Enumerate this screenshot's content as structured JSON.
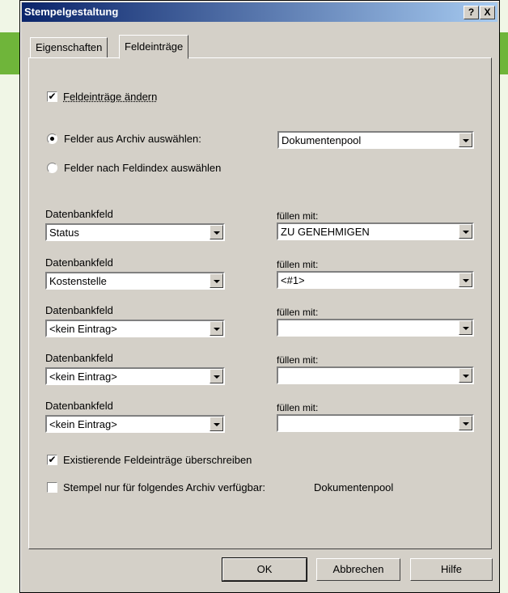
{
  "window": {
    "title": "Stempelgestaltung",
    "help_label": "?",
    "close_label": "X"
  },
  "tabs": [
    {
      "label": "Eigenschaften",
      "active": false
    },
    {
      "label": "Feldeinträge",
      "active": true
    }
  ],
  "feld": {
    "change_label": "Feldeinträge ändern",
    "change_checked": true,
    "archive_radio_label": "Felder aus Archiv auswählen:",
    "index_radio_label": "Felder nach Feldindex auswählen",
    "archive_selected": "Dokumentenpool"
  },
  "rows": [
    {
      "field_label": "Datenbankfeld",
      "field_value": "Status",
      "fill_label": "füllen mit:",
      "fill_value": "ZU GENEHMIGEN"
    },
    {
      "field_label": "Datenbankfeld",
      "field_value": "Kostenstelle",
      "fill_label": "füllen mit:",
      "fill_value": "<#1>"
    },
    {
      "field_label": "Datenbankfeld",
      "field_value": "<kein Eintrag>",
      "fill_label": "füllen mit:",
      "fill_value": ""
    },
    {
      "field_label": "Datenbankfeld",
      "field_value": "<kein Eintrag>",
      "fill_label": "füllen mit:",
      "fill_value": ""
    },
    {
      "field_label": "Datenbankfeld",
      "field_value": "<kein Eintrag>",
      "fill_label": "füllen mit:",
      "fill_value": ""
    }
  ],
  "options": {
    "overwrite_label": "Existierende Feldeinträge überschreiben",
    "overwrite_checked": true,
    "archive_only_label": "Stempel nur für folgendes Archiv verfügbar:",
    "archive_only_checked": false,
    "archive_only_value": "Dokumentenpool"
  },
  "buttons": {
    "ok": "OK",
    "cancel": "Abbrechen",
    "help": "Hilfe"
  }
}
